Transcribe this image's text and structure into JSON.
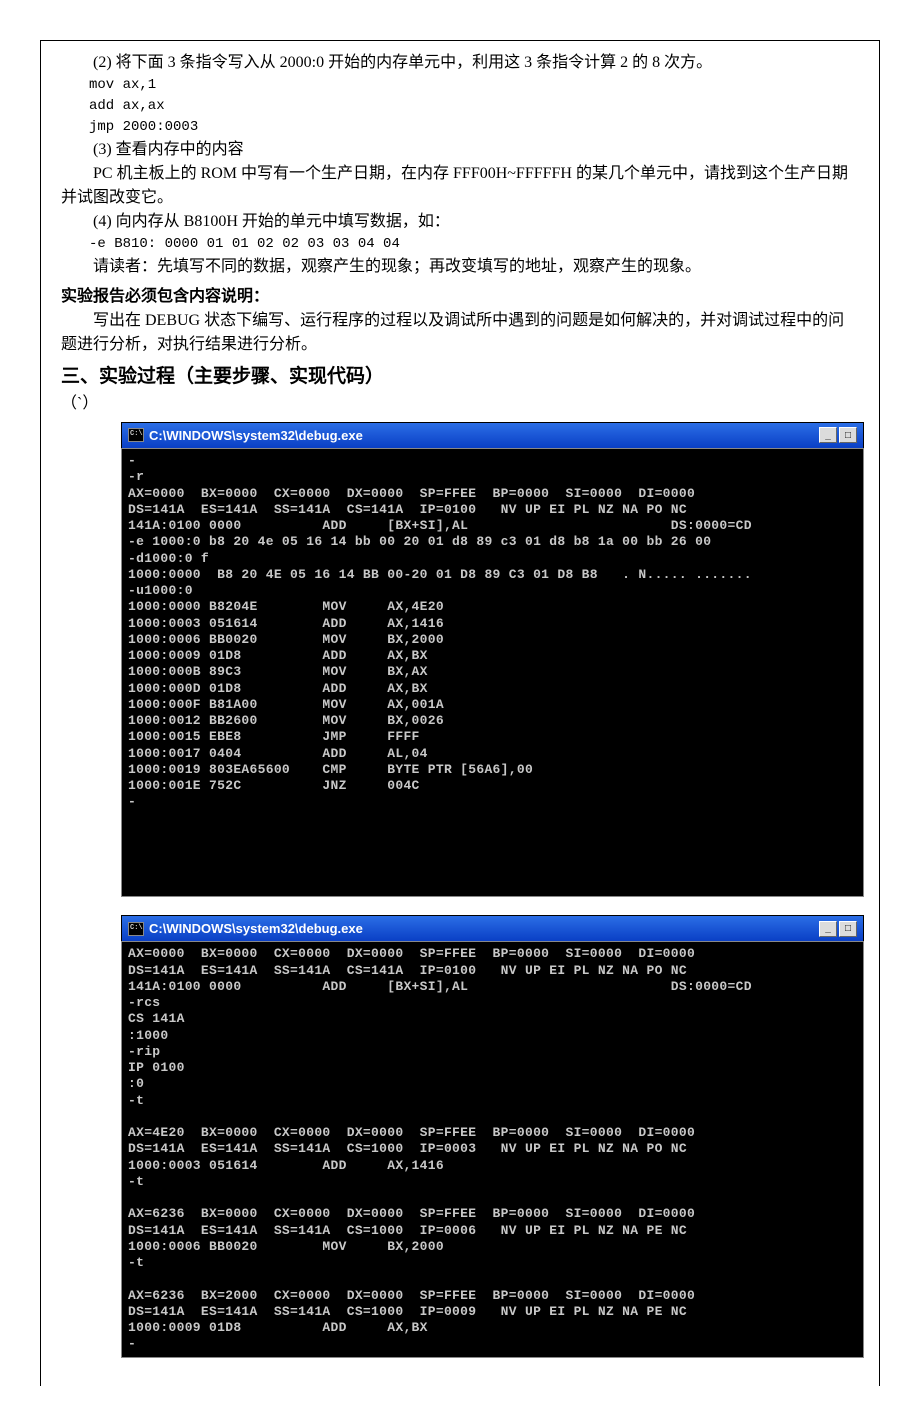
{
  "body": {
    "p1": "(2)   将下面 3 条指令写入从 2000:0 开始的内存单元中，利用这 3 条指令计算 2 的 8 次方。",
    "c1": "mov ax,1",
    "c2": "add ax,ax",
    "c3": "jmp 2000:0003",
    "p2": "(3)   查看内存中的内容",
    "p3": "PC 机主板上的 ROM 中写有一个生产日期，在内存 FFF00H~FFFFFH 的某几个单元中，请找到这个生产日期并试图改变它。",
    "p4": "(4)   向内存从 B8100H 开始的单元中填写数据，如：",
    "c4": "-e B810: 0000 01 01 02 02 03 03 04 04",
    "p5": "请读者：先填写不同的数据，观察产生的现象；再改变填写的地址，观察产生的现象。",
    "h1": "实验报告必须包含内容说明：",
    "p6": "写出在 DEBUG 状态下编写、运行程序的过程以及调试所中遇到的问题是如何解决的，并对调试过程中的问题进行分析，对执行结果进行分析。",
    "h2": "三、实验过程（主要步骤、实现代码）",
    "p7": "（`）"
  },
  "term": {
    "title": "C:\\WINDOWS\\system32\\debug.exe",
    "block1": "-\n-r\nAX=0000  BX=0000  CX=0000  DX=0000  SP=FFEE  BP=0000  SI=0000  DI=0000\nDS=141A  ES=141A  SS=141A  CS=141A  IP=0100   NV UP EI PL NZ NA PO NC\n141A:0100 0000          ADD     [BX+SI],AL                         DS:0000=CD\n-e 1000:0 b8 20 4e 05 16 14 bb 00 20 01 d8 89 c3 01 d8 b8 1a 00 bb 26 00\n-d1000:0 f\n1000:0000  B8 20 4E 05 16 14 BB 00-20 01 D8 89 C3 01 D8 B8   . N..... .......\n-u1000:0\n1000:0000 B8204E        MOV     AX,4E20\n1000:0003 051614        ADD     AX,1416\n1000:0006 BB0020        MOV     BX,2000\n1000:0009 01D8          ADD     AX,BX\n1000:000B 89C3          MOV     BX,AX\n1000:000D 01D8          ADD     AX,BX\n1000:000F B81A00        MOV     AX,001A\n1000:0012 BB2600        MOV     BX,0026\n1000:0015 EBE8          JMP     FFFF\n1000:0017 0404          ADD     AL,04\n1000:0019 803EA65600    CMP     BYTE PTR [56A6],00\n1000:001E 752C          JNZ     004C\n-\n\n\n\n\n\n",
    "block2": "AX=0000  BX=0000  CX=0000  DX=0000  SP=FFEE  BP=0000  SI=0000  DI=0000\nDS=141A  ES=141A  SS=141A  CS=141A  IP=0100   NV UP EI PL NZ NA PO NC\n141A:0100 0000          ADD     [BX+SI],AL                         DS:0000=CD\n-rcs\nCS 141A\n:1000\n-rip\nIP 0100\n:0\n-t\n\nAX=4E20  BX=0000  CX=0000  DX=0000  SP=FFEE  BP=0000  SI=0000  DI=0000\nDS=141A  ES=141A  SS=141A  CS=1000  IP=0003   NV UP EI PL NZ NA PO NC\n1000:0003 051614        ADD     AX,1416\n-t\n\nAX=6236  BX=0000  CX=0000  DX=0000  SP=FFEE  BP=0000  SI=0000  DI=0000\nDS=141A  ES=141A  SS=141A  CS=1000  IP=0006   NV UP EI PL NZ NA PE NC\n1000:0006 BB0020        MOV     BX,2000\n-t\n\nAX=6236  BX=2000  CX=0000  DX=0000  SP=FFEE  BP=0000  SI=0000  DI=0000\nDS=141A  ES=141A  SS=141A  CS=1000  IP=0009   NV UP EI PL NZ NA PE NC\n1000:0009 01D8          ADD     AX,BX\n-"
  },
  "buttons": {
    "min": "_",
    "max": "□"
  }
}
